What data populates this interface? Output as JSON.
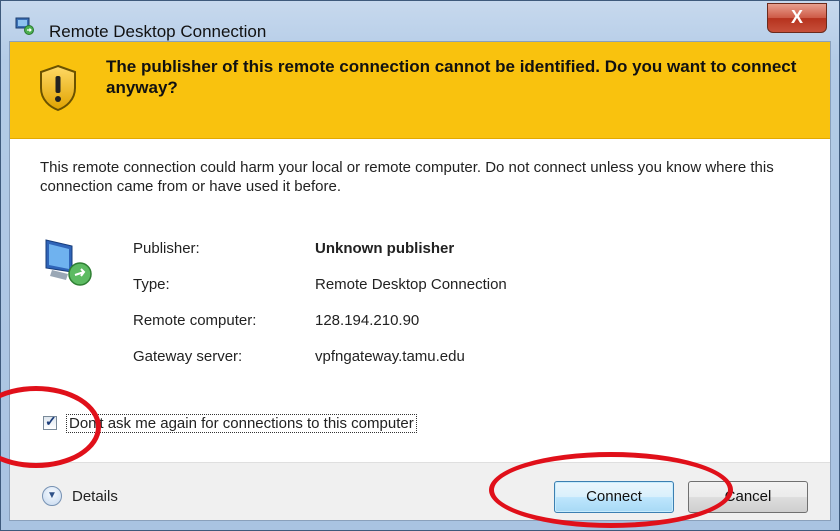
{
  "window": {
    "title": "Remote Desktop Connection",
    "close_label": "X"
  },
  "warning": {
    "message": "The publisher of this remote connection cannot be identified. Do you want to connect anyway?"
  },
  "description": "This remote connection could harm your local or remote computer. Do not connect unless you know where this connection came from or have used it before.",
  "details": {
    "publisher_label": "Publisher:",
    "publisher_value": "Unknown publisher",
    "type_label": "Type:",
    "type_value": "Remote Desktop Connection",
    "remote_label": "Remote computer:",
    "remote_value": "128.194.210.90",
    "gateway_label": "Gateway server:",
    "gateway_value": "vpfngateway.tamu.edu"
  },
  "checkbox": {
    "checked": true,
    "label": "Don't ask me again for connections to this computer"
  },
  "footer": {
    "details_label": "Details",
    "connect_label": "Connect",
    "cancel_label": "Cancel"
  },
  "colors": {
    "warning_banner": "#f9c20e",
    "annotation_circle": "#e0101a"
  },
  "icons": [
    "remote-desktop-app-icon",
    "warning-shield-icon",
    "remote-monitor-icon",
    "checkmark-icon",
    "chevron-down-icon"
  ]
}
